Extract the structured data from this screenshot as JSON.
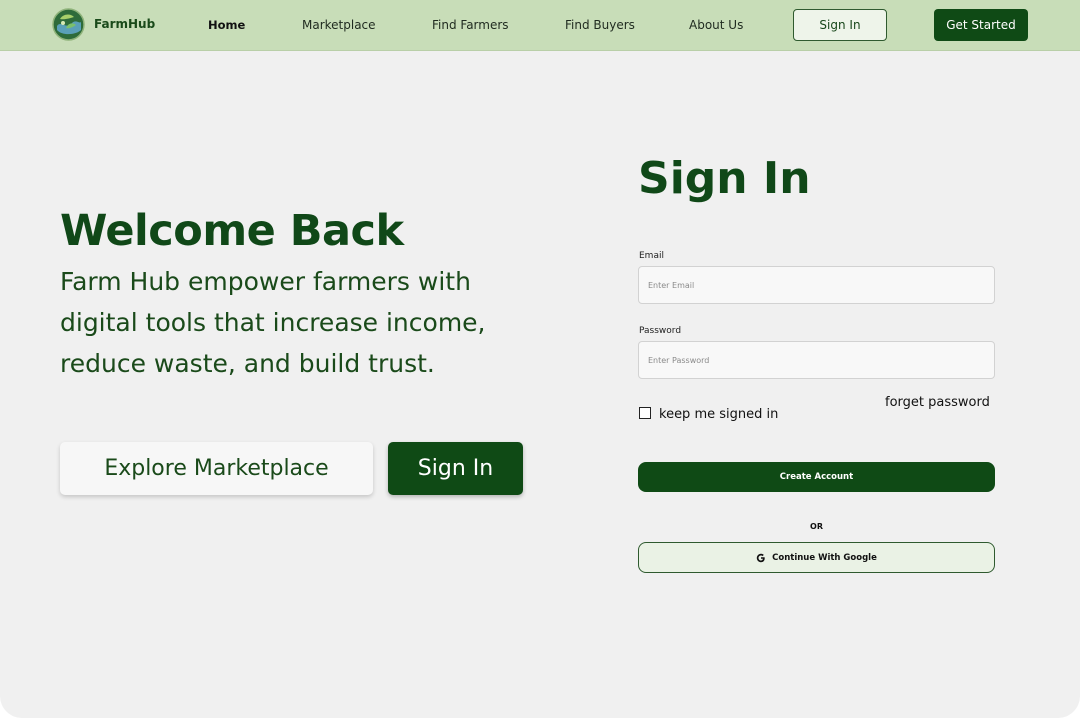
{
  "colors": {
    "brand_dark_green": "#0f4a15",
    "nav_bg": "#c8ddb8",
    "page_bg": "#f0f0f0"
  },
  "nav": {
    "brand": "FarmHub",
    "logo_icon": "farmhub-globe-logo",
    "links": [
      "Home",
      "Marketplace",
      "Find Farmers",
      "Find Buyers",
      "About Us"
    ],
    "active_link": "Home",
    "signin_label": "Sign In",
    "cta_label": "Get Started"
  },
  "hero": {
    "title": "Welcome Back",
    "description": "Farm Hub  empower farmers with digital tools that increase income, reduce waste, and build trust.",
    "explore_button": "Explore Marketplace",
    "signin_button": "Sign In"
  },
  "form": {
    "title": "Sign In",
    "email_label": "Email",
    "email_placeholder": "Enter Email",
    "email_value": "",
    "password_label": "Password",
    "password_placeholder": "Enter Password",
    "password_value": "",
    "remember_label": "keep me signed in",
    "remember_checked": false,
    "forget_label": "forget password",
    "create_button": "Create Account",
    "or_text": "OR",
    "google_button": "Continue With Google",
    "google_icon": "google-g-icon"
  }
}
